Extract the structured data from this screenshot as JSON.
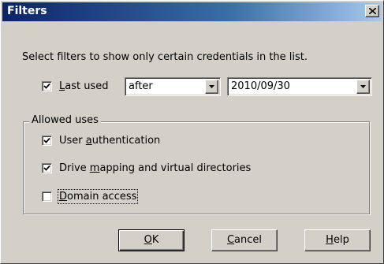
{
  "window": {
    "title": "Filters",
    "close_label": "close"
  },
  "intro_text": "Select filters to show only certain credentials in the list.",
  "last_used": {
    "checked": true,
    "label_first": "L",
    "label_rest": "ast used",
    "operator": {
      "selected": "after"
    },
    "date": {
      "selected": "2010/09/30"
    }
  },
  "allowed_uses": {
    "group_label": "Allowed uses",
    "items": [
      {
        "checked": true,
        "label_pre": "User ",
        "label_accel": "a",
        "label_post": "uthentication"
      },
      {
        "checked": true,
        "label_pre": "Drive ",
        "label_accel": "m",
        "label_post": "apping and virtual directories"
      },
      {
        "checked": false,
        "label_pre": "",
        "label_accel": "D",
        "label_post": "omain access"
      }
    ]
  },
  "buttons": {
    "ok_accel": "O",
    "ok_rest": "K",
    "cancel_accel": "C",
    "cancel_rest": "ancel",
    "help_accel": "H",
    "help_rest": "elp"
  },
  "colors": {
    "titlebar_start": "#0a246a",
    "titlebar_end": "#a6caf0",
    "face": "#d4d0c8"
  },
  "icons": {
    "close": "close-icon",
    "check": "check-icon",
    "dropdown": "chevron-down-icon"
  }
}
